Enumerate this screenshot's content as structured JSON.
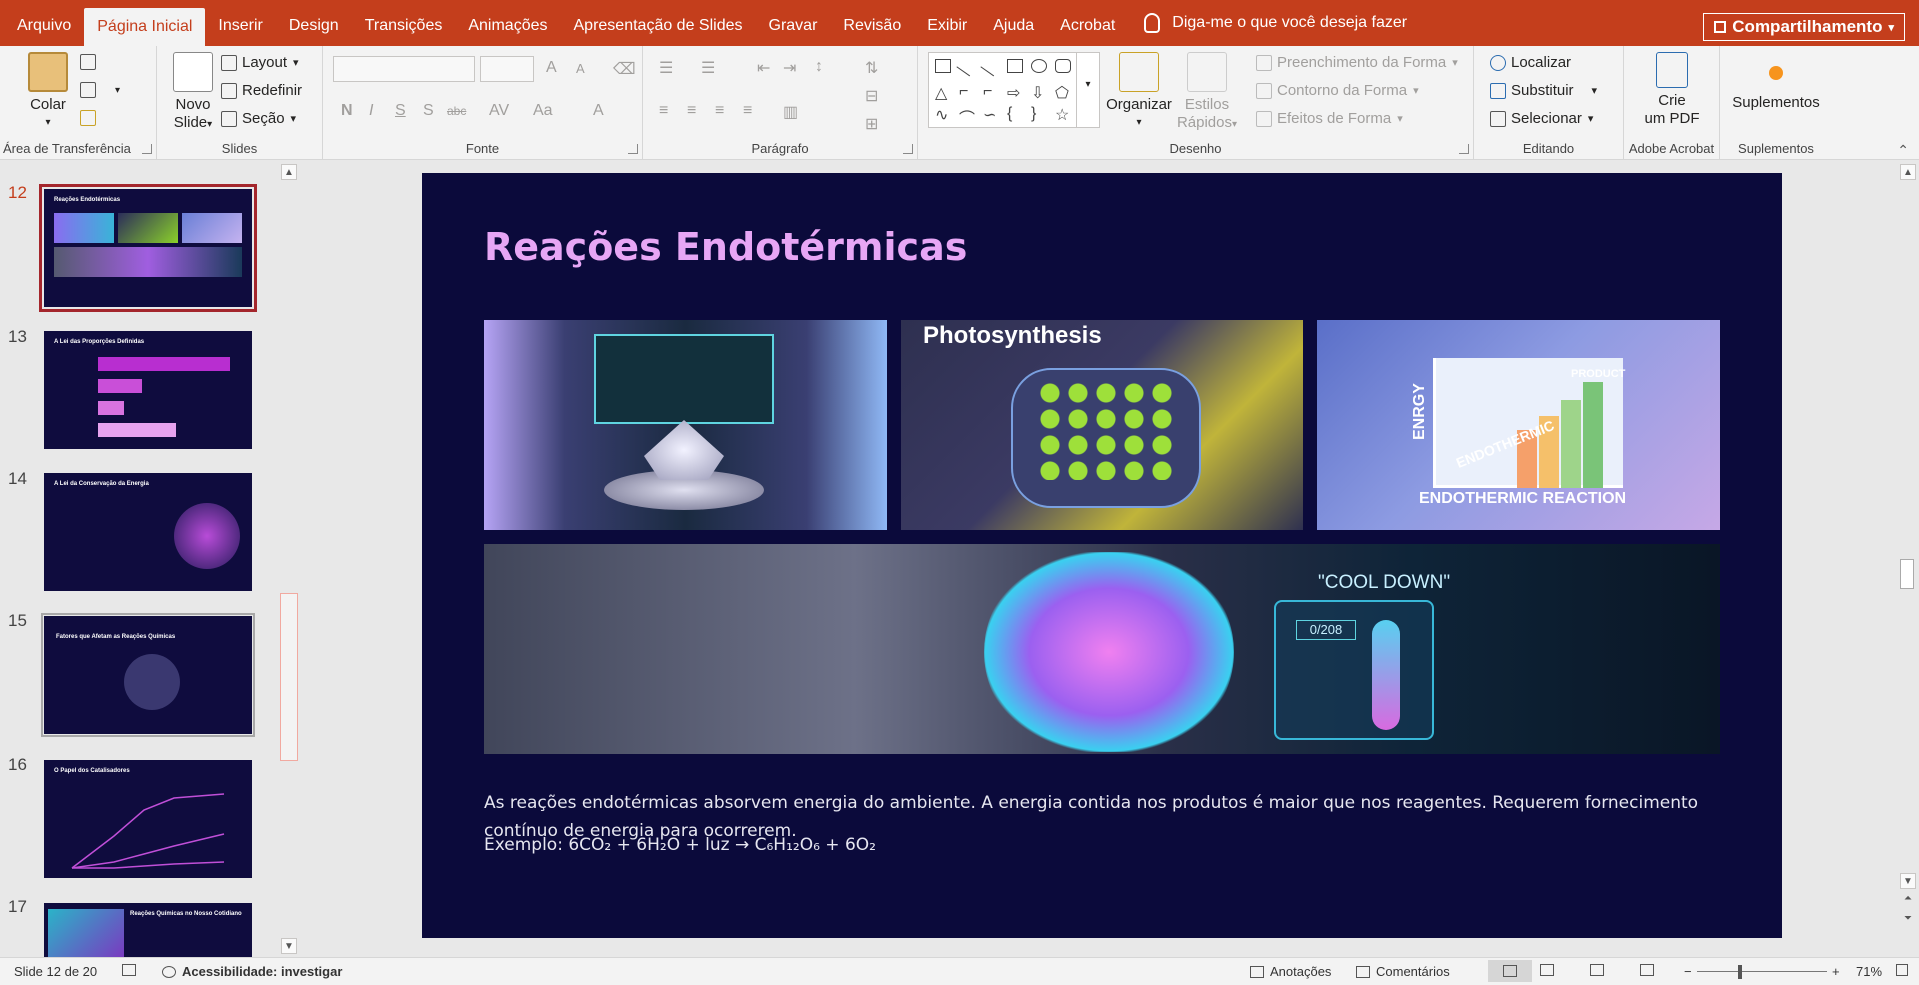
{
  "menu": {
    "tabs": [
      "Arquivo",
      "Página Inicial",
      "Inserir",
      "Design",
      "Transições",
      "Animações",
      "Apresentação de Slides",
      "Gravar",
      "Revisão",
      "Exibir",
      "Ajuda",
      "Acrobat"
    ],
    "active_tab": "Página Inicial",
    "tell_me": "Diga-me o que você deseja fazer",
    "share": "Compartilhamento"
  },
  "ribbon": {
    "clipboard": {
      "paste": "Colar",
      "label": "Área de Transferência"
    },
    "slides": {
      "new_slide_1": "Novo",
      "new_slide_2": "Slide",
      "layout": "Layout",
      "reset": "Redefinir",
      "section": "Seção",
      "label": "Slides"
    },
    "font": {
      "label": "Fonte"
    },
    "paragraph": {
      "label": "Parágrafo"
    },
    "drawing": {
      "arrange": "Organizar",
      "quick_styles_1": "Estilos",
      "quick_styles_2": "Rápidos",
      "shape_fill": "Preenchimento da Forma",
      "shape_outline": "Contorno da Forma",
      "shape_effects": "Efeitos de Forma",
      "label": "Desenho"
    },
    "editing": {
      "find": "Localizar",
      "replace": "Substituir",
      "select": "Selecionar",
      "label": "Editando"
    },
    "acrobat": {
      "create_pdf_1": "Crie",
      "create_pdf_2": "um PDF",
      "label": "Adobe Acrobat"
    },
    "addins": {
      "addins": "Suplementos",
      "label": "Suplementos"
    }
  },
  "thumbnails": [
    {
      "num": "12",
      "title": "Reações Endotérmicas"
    },
    {
      "num": "13",
      "title": "A Lei das Proporções Definidas"
    },
    {
      "num": "14",
      "title": "A Lei da Conservação da Energia"
    },
    {
      "num": "15",
      "title": "Fatores que Afetam as Reações Químicas"
    },
    {
      "num": "16",
      "title": "O Papel dos Catalisadores"
    },
    {
      "num": "17",
      "title": "Reações Químicas no Nosso Cotidiano"
    }
  ],
  "slide": {
    "title": "Reações Endotérmicas",
    "image_labels": {
      "photosynthesis": "Photosynthesis",
      "product": "PRODUCT",
      "energy": "ENRGY",
      "endothermic": "ENDOTHERMIC",
      "reaction": "ENDOTHERMIC REACTION",
      "cool_down": "\"COOL DOWN\"",
      "display_value": "0/208"
    },
    "body": "As reações endotérmicas absorvem energia do ambiente. A energia contida nos produtos é maior que nos reagentes. Requerem fornecimento contínuo de energia para ocorrerem.",
    "example": "Exemplo: 6CO₂ + 6H₂O + luz → C₆H₁₂O₆ + 6O₂"
  },
  "status": {
    "slide_of": "Slide 12 de 20",
    "accessibility": "Acessibilidade: investigar",
    "notes": "Anotações",
    "comments": "Comentários",
    "zoom": "71%"
  },
  "colors": {
    "accent": "#c43e1c",
    "slide_bg": "#0b0a3b",
    "title": "#e7a6f5"
  }
}
